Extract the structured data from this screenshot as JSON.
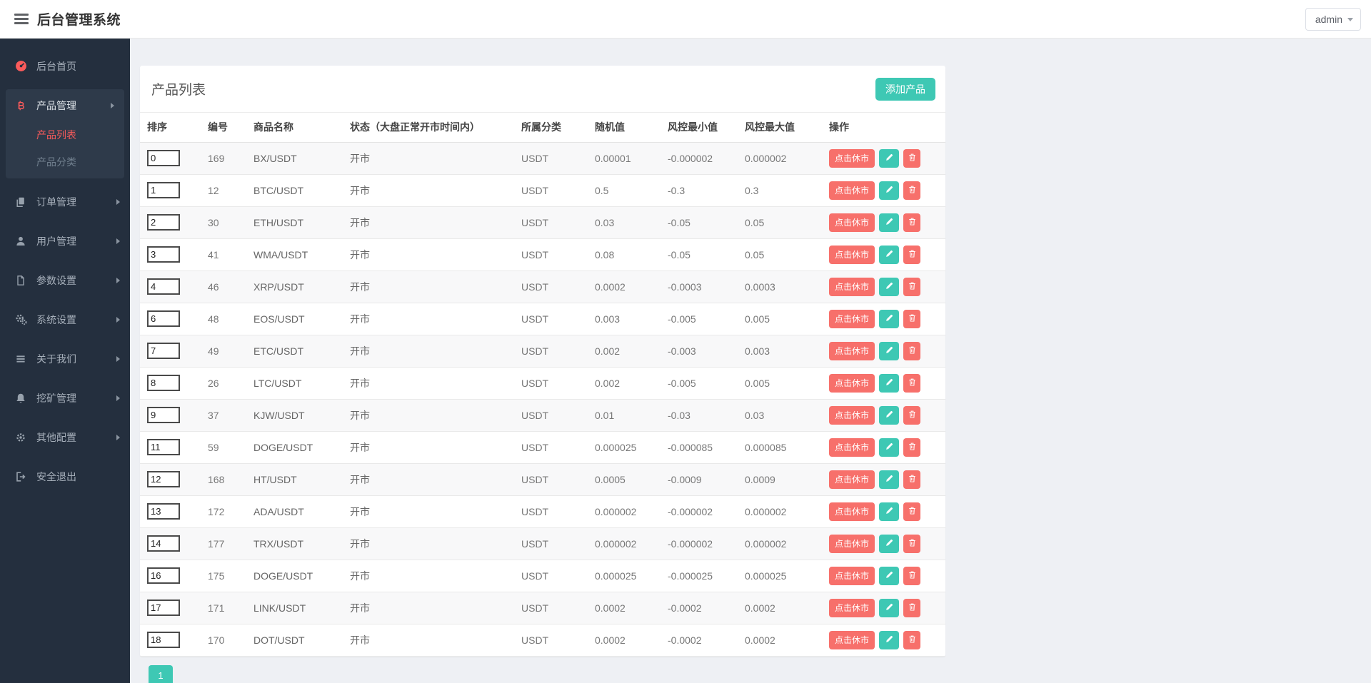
{
  "header": {
    "title": "后台管理系统",
    "user": "admin"
  },
  "sidebar": {
    "items": [
      {
        "key": "home",
        "label": "后台首页",
        "icon": "tachometer-icon",
        "icon_color": "red",
        "has_arrow": false
      },
      {
        "key": "product-manage",
        "label": "产品管理",
        "icon": "bitcoin-icon",
        "icon_color": "red",
        "has_arrow": true,
        "expanded": true,
        "children": [
          {
            "key": "product-list",
            "label": "产品列表",
            "active": true
          },
          {
            "key": "product-category",
            "label": "产品分类",
            "active": false
          }
        ]
      },
      {
        "key": "order-manage",
        "label": "订单管理",
        "icon": "copy-icon",
        "icon_color": "gray",
        "has_arrow": true
      },
      {
        "key": "user-manage",
        "label": "用户管理",
        "icon": "user-icon",
        "icon_color": "gray",
        "has_arrow": true
      },
      {
        "key": "param-settings",
        "label": "参数设置",
        "icon": "file-icon",
        "icon_color": "gray",
        "has_arrow": true
      },
      {
        "key": "system-settings",
        "label": "系统设置",
        "icon": "gears-icon",
        "icon_color": "gray",
        "has_arrow": true
      },
      {
        "key": "about-us",
        "label": "关于我们",
        "icon": "list-icon",
        "icon_color": "gray",
        "has_arrow": true
      },
      {
        "key": "mining-manage",
        "label": "挖矿管理",
        "icon": "bell-icon",
        "icon_color": "gray",
        "has_arrow": true
      },
      {
        "key": "other-config",
        "label": "其他配置",
        "icon": "gear-icon",
        "icon_color": "gray",
        "has_arrow": true
      },
      {
        "key": "logout",
        "label": "安全退出",
        "icon": "signout-icon",
        "icon_color": "gray",
        "has_arrow": false
      }
    ]
  },
  "main": {
    "card_title": "产品列表",
    "add_button": "添加产品",
    "table": {
      "headers": [
        "排序",
        "编号",
        "商品名称",
        "状态（大盘正常开市时间内）",
        "所属分类",
        "随机值",
        "风控最小值",
        "风控最大值",
        "操作"
      ],
      "action_close_label": "点击休市",
      "action_icons": {
        "edit": "pencil-icon",
        "delete": "trash-icon"
      },
      "rows": [
        {
          "sort": "0",
          "id": "169",
          "name": "BX/USDT",
          "status": "开市",
          "category": "USDT",
          "random": "0.00001",
          "risk_min": "-0.000002",
          "risk_max": "0.000002"
        },
        {
          "sort": "1",
          "id": "12",
          "name": "BTC/USDT",
          "status": "开市",
          "category": "USDT",
          "random": "0.5",
          "risk_min": "-0.3",
          "risk_max": "0.3"
        },
        {
          "sort": "2",
          "id": "30",
          "name": "ETH/USDT",
          "status": "开市",
          "category": "USDT",
          "random": "0.03",
          "risk_min": "-0.05",
          "risk_max": "0.05"
        },
        {
          "sort": "3",
          "id": "41",
          "name": "WMA/USDT",
          "status": "开市",
          "category": "USDT",
          "random": "0.08",
          "risk_min": "-0.05",
          "risk_max": "0.05"
        },
        {
          "sort": "4",
          "id": "46",
          "name": "XRP/USDT",
          "status": "开市",
          "category": "USDT",
          "random": "0.0002",
          "risk_min": "-0.0003",
          "risk_max": "0.0003"
        },
        {
          "sort": "6",
          "id": "48",
          "name": "EOS/USDT",
          "status": "开市",
          "category": "USDT",
          "random": "0.003",
          "risk_min": "-0.005",
          "risk_max": "0.005"
        },
        {
          "sort": "7",
          "id": "49",
          "name": "ETC/USDT",
          "status": "开市",
          "category": "USDT",
          "random": "0.002",
          "risk_min": "-0.003",
          "risk_max": "0.003"
        },
        {
          "sort": "8",
          "id": "26",
          "name": "LTC/USDT",
          "status": "开市",
          "category": "USDT",
          "random": "0.002",
          "risk_min": "-0.005",
          "risk_max": "0.005"
        },
        {
          "sort": "9",
          "id": "37",
          "name": "KJW/USDT",
          "status": "开市",
          "category": "USDT",
          "random": "0.01",
          "risk_min": "-0.03",
          "risk_max": "0.03"
        },
        {
          "sort": "11",
          "id": "59",
          "name": "DOGE/USDT",
          "status": "开市",
          "category": "USDT",
          "random": "0.000025",
          "risk_min": "-0.000085",
          "risk_max": "0.000085"
        },
        {
          "sort": "12",
          "id": "168",
          "name": "HT/USDT",
          "status": "开市",
          "category": "USDT",
          "random": "0.0005",
          "risk_min": "-0.0009",
          "risk_max": "0.0009"
        },
        {
          "sort": "13",
          "id": "172",
          "name": "ADA/USDT",
          "status": "开市",
          "category": "USDT",
          "random": "0.000002",
          "risk_min": "-0.000002",
          "risk_max": "0.000002"
        },
        {
          "sort": "14",
          "id": "177",
          "name": "TRX/USDT",
          "status": "开市",
          "category": "USDT",
          "random": "0.000002",
          "risk_min": "-0.000002",
          "risk_max": "0.000002"
        },
        {
          "sort": "16",
          "id": "175",
          "name": "DOGE/USDT",
          "status": "开市",
          "category": "USDT",
          "random": "0.000025",
          "risk_min": "-0.000025",
          "risk_max": "0.000025"
        },
        {
          "sort": "17",
          "id": "171",
          "name": "LINK/USDT",
          "status": "开市",
          "category": "USDT",
          "random": "0.0002",
          "risk_min": "-0.0002",
          "risk_max": "0.0002"
        },
        {
          "sort": "18",
          "id": "170",
          "name": "DOT/USDT",
          "status": "开市",
          "category": "USDT",
          "random": "0.0002",
          "risk_min": "-0.0002",
          "risk_max": "0.0002"
        }
      ]
    },
    "pagination": {
      "current_page": "1"
    }
  },
  "colors": {
    "teal": "#3EC8B4",
    "salmon": "#F7706B",
    "sidebar_bg": "#242F3E",
    "sidebar_group_bg": "#2E3A4A",
    "accent_red": "#FA5B5B",
    "page_bg": "#EEF0F4"
  }
}
